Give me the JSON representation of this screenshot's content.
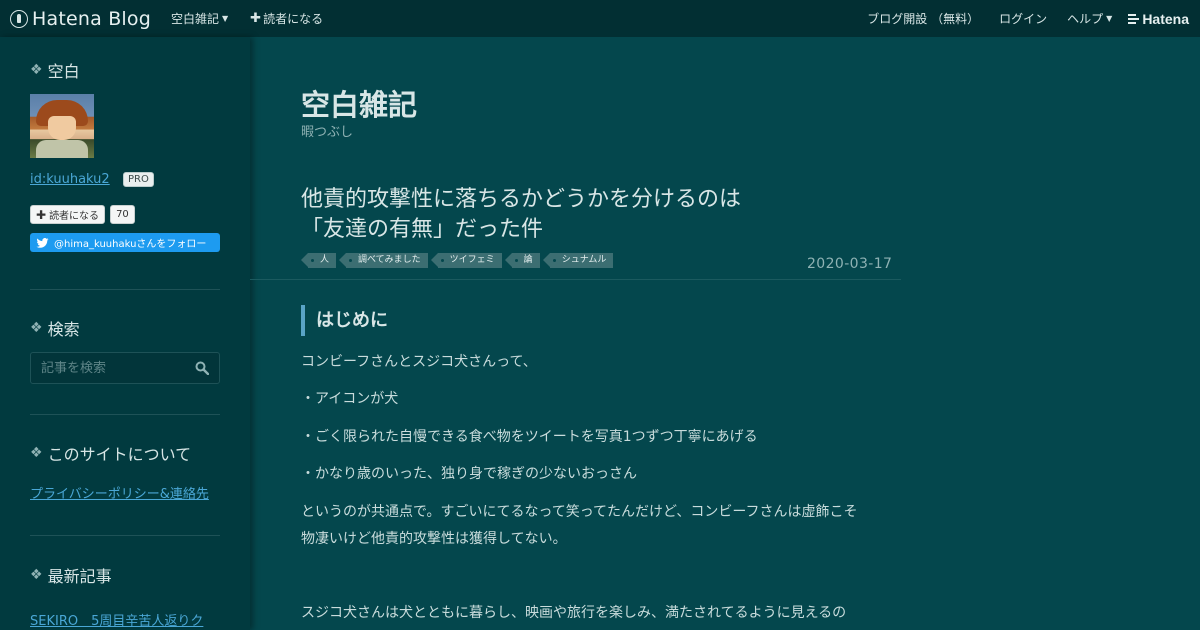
{
  "topbar": {
    "brand": "Hatena Blog",
    "blog_menu": "空白雑記",
    "subscribe": "読者になる",
    "create_blog": "ブログ開設 （無料）",
    "login": "ログイン",
    "help": "ヘルプ",
    "hatena": "Hatena"
  },
  "sidebar": {
    "profile_heading": "空白",
    "user_id": "id:kuuhaku2",
    "pro_badge": "PRO",
    "subscribe_button": "読者になる",
    "subscriber_count": "70",
    "twitter_follow": "@hima_kuuhakuさんをフォロー",
    "search_heading": "検索",
    "search_placeholder": "記事を検索",
    "about_heading": "このサイトについて",
    "about_link": "プライバシーポリシー&連絡先",
    "recent_heading": "最新記事",
    "recent_link": "SEKIRO　5周目辛苦人返りク"
  },
  "blog": {
    "title": "空白雑記",
    "description": "暇つぶし"
  },
  "entry": {
    "title_line1": "他責的攻撃性に落ちるかどうかを分けるのは",
    "title_line2": "「友達の有無」だった件",
    "categories": [
      "人",
      "調べてみました",
      "ツイフェミ",
      "論",
      "シュナムル"
    ],
    "date": "2020-03-17",
    "section_heading": "はじめに",
    "paragraphs": [
      "コンビーフさんとスジコ犬さんって、",
      "・アイコンが犬",
      "・ごく限られた自慢できる食べ物をツイートを写真1つずつ丁寧にあげる",
      "・かなり歳のいった、独り身で稼ぎの少ないおっさん",
      "というのが共通点で。すごいにてるなって笑ってたんだけど、コンビーフさんは虚飾こそ",
      "物凄いけど他責的攻撃性は獲得してない。",
      "スジコ犬さんは犬とともに暮らし、映画や旅行を楽しみ、満たされてるように見えるの"
    ]
  },
  "colors": {
    "background": "#04474d",
    "sidebar": "#013a3f",
    "topbar": "#022f33",
    "link": "#4aa7d6",
    "twitter": "#1d9bf0"
  }
}
